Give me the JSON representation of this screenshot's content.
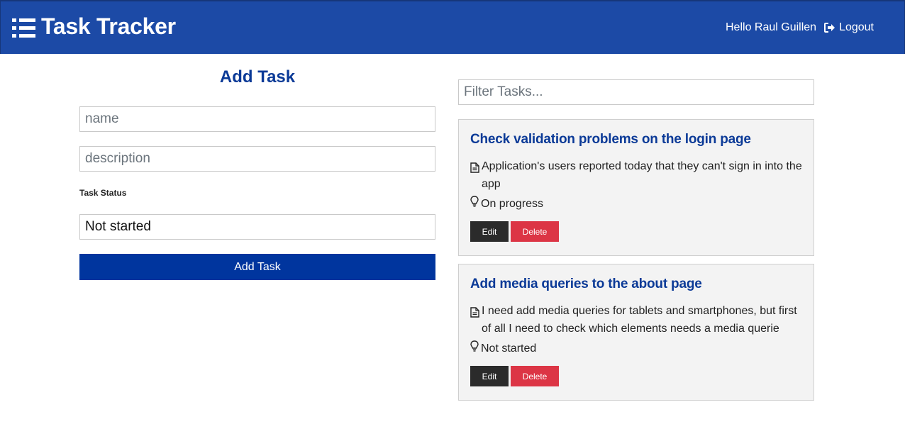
{
  "header": {
    "brand": "Task Tracker",
    "brand_icon": "list-icon",
    "greeting": "Hello Raul Guillen",
    "logout_label": "Logout",
    "logout_icon": "sign-out-icon",
    "background_color": "#1c4aa6"
  },
  "form": {
    "title": "Add Task",
    "name_placeholder": "name",
    "description_placeholder": "description",
    "status_label": "Task Status",
    "status_selected": "Not started",
    "submit_label": "Add Task",
    "submit_color": "#00359e"
  },
  "filter": {
    "placeholder": "Filter Tasks..."
  },
  "tasks": [
    {
      "title": "Check validation problems on the login page",
      "description": "Application's users reported today that they can't sign in into the app",
      "status": "On progress",
      "edit_label": "Edit",
      "delete_label": "Delete"
    },
    {
      "title": "Add media queries to the about page",
      "description": "I need add media queries for tablets and smartphones, but first of all I need to check which elements needs a media querie",
      "status": "Not started",
      "edit_label": "Edit",
      "delete_label": "Delete"
    }
  ],
  "colors": {
    "title_blue": "#0b3a97",
    "delete_red": "#dc3545",
    "edit_dark": "#2b2b2b",
    "card_bg": "#f3f3f3"
  }
}
